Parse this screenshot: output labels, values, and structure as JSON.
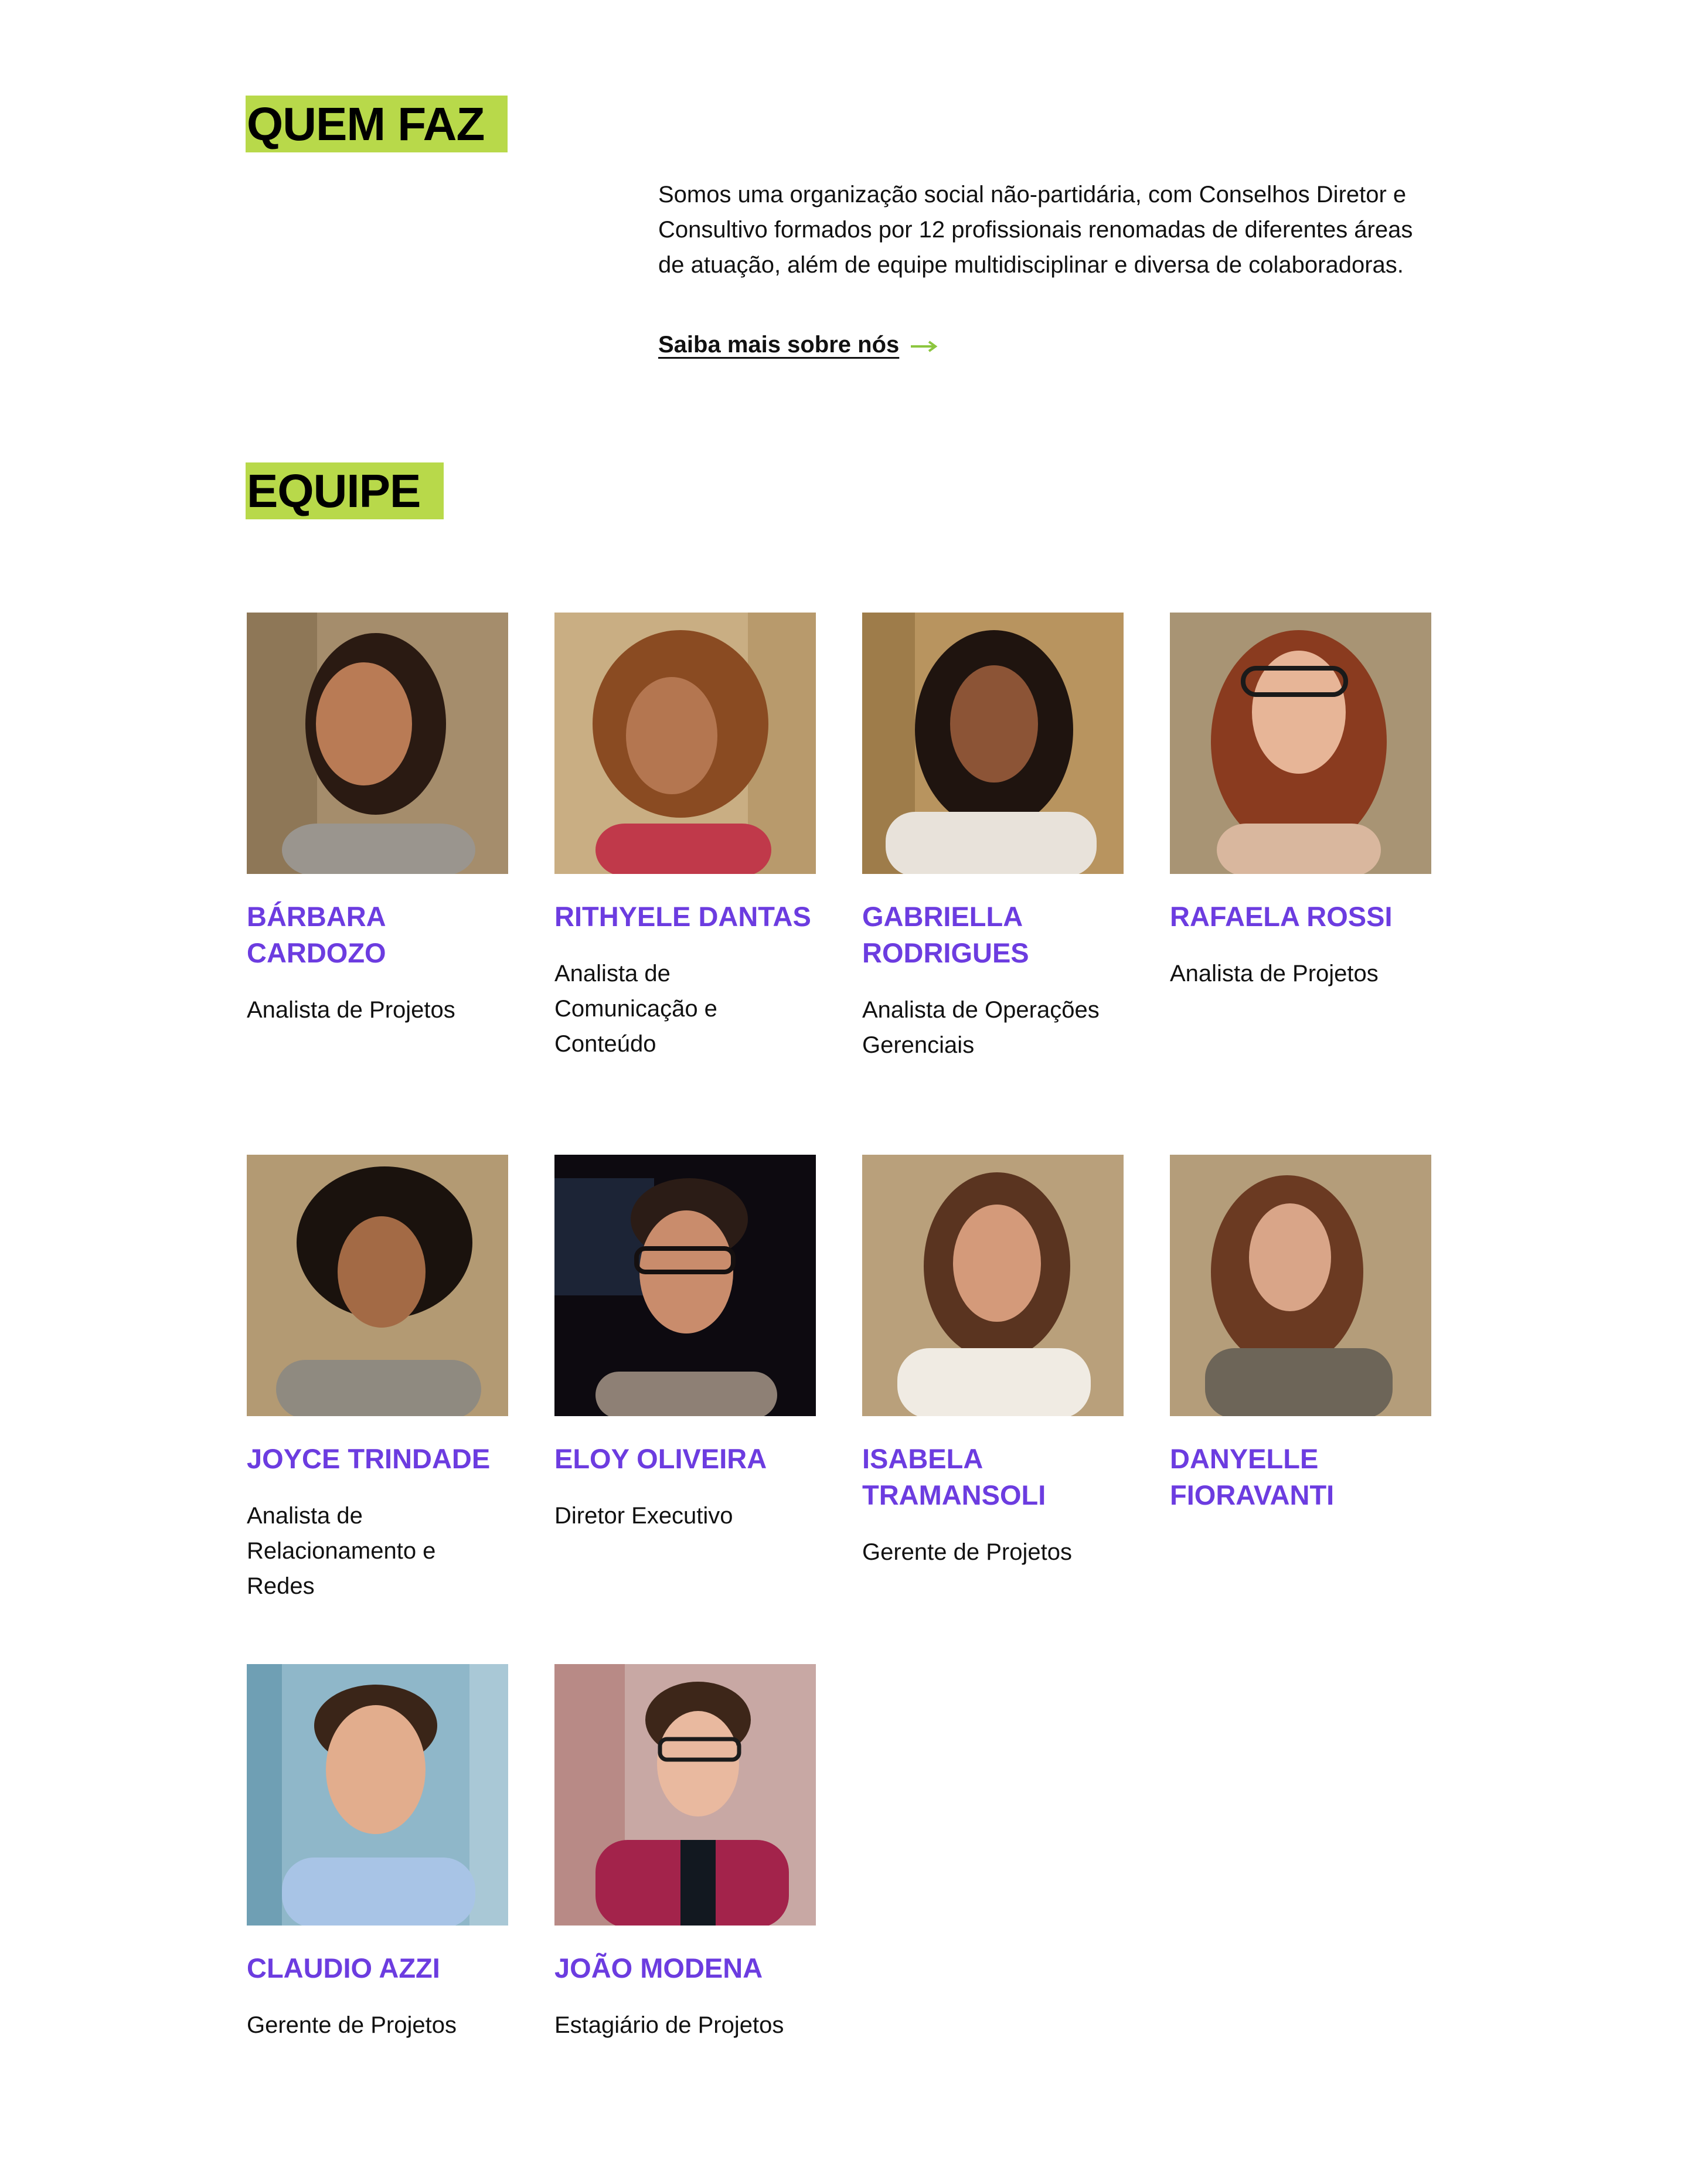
{
  "who": {
    "title": "QUEM FAZ",
    "description": "Somos uma organização social não-partidária, com Conselhos Diretor e Consultivo formados por 12 profissionais renomadas de diferentes áreas de atuação, além de equipe multidisciplinar e diversa de colaboradoras.",
    "link_label": "Saiba mais sobre nós"
  },
  "team": {
    "title": "EQUIPE",
    "members": [
      {
        "name": "BÁRBARA CARDOZO",
        "role": "Analista de Projetos"
      },
      {
        "name": "RITHYELE DANTAS",
        "role": "Analista de Comunicação e Conteúdo"
      },
      {
        "name": "GABRIELLA RODRIGUES",
        "role": "Analista de Operações Gerenciais"
      },
      {
        "name": "RAFAELA ROSSI",
        "role": "Analista de Projetos"
      },
      {
        "name": "JOYCE TRINDADE",
        "role": "Analista de Relacionamento e Redes"
      },
      {
        "name": "ELOY OLIVEIRA",
        "role": "Diretor Executivo"
      },
      {
        "name": "ISABELA TRAMANSOLI",
        "role": "Gerente de Projetos"
      },
      {
        "name": "DANYELLE FIORAVANTI",
        "role": ""
      },
      {
        "name": "CLAUDIO AZZI",
        "role": "Gerente de Projetos"
      },
      {
        "name": "JOÃO MODENA",
        "role": "Estagiário de Projetos"
      }
    ]
  },
  "colors": {
    "highlight": "#b8d94a",
    "name_accent": "#6c3ce0",
    "arrow": "#8cc63f"
  }
}
